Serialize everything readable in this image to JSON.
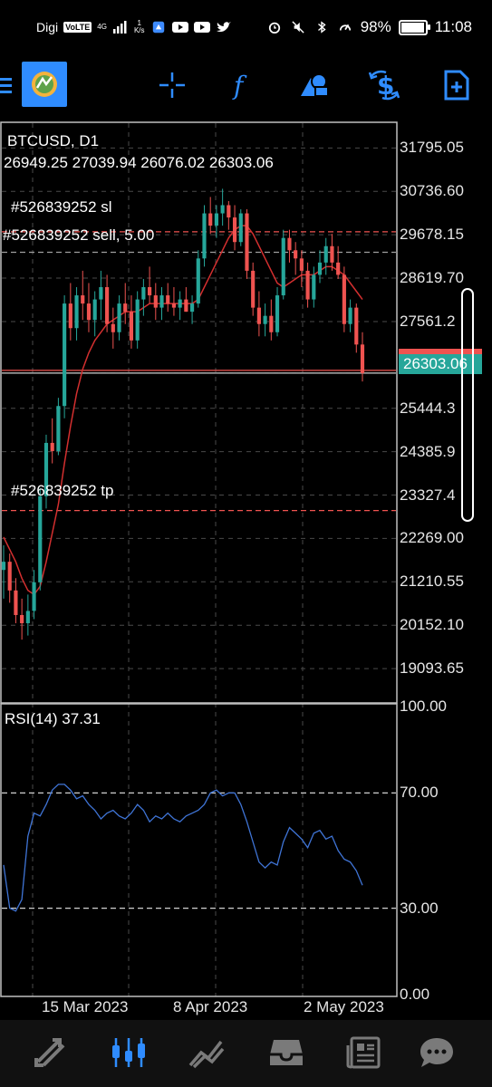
{
  "status_bar": {
    "carrier": "Digi",
    "volte": "VoLTE",
    "network": "4G",
    "speed_top": "1",
    "speed_bottom": "K/s",
    "battery": "98%",
    "time": "11:08"
  },
  "toolbar": {
    "icons": [
      "menu-icon",
      "app-logo-icon",
      "crosshair-icon",
      "function-icon",
      "objects-icon",
      "symbol-change-icon",
      "new-order-icon"
    ]
  },
  "chart": {
    "symbol_line": "BTCUSD, D1",
    "ohlc_line": "26949.25 27039.94 26076.02 26303.06",
    "sl_label": "#526839252 sl",
    "sell_label": "#526839252 sell, 5.00",
    "tp_label": "#526839252 tp",
    "price_tag": "26303.06",
    "rsi_label": "RSI(14) 37.31"
  },
  "chart_data": {
    "type": "candlestick",
    "symbol": "BTCUSD",
    "timeframe": "D1",
    "y_ticks": [
      "31795.05",
      "30736.60",
      "29678.15",
      "28619.70",
      "27561.2",
      "26303.06",
      "25444.3",
      "24385.9",
      "23327.4",
      "22269.00",
      "21210.55",
      "20152.10",
      "19093.65"
    ],
    "x_ticks": [
      "15 Mar 2023",
      "8 Apr 2023",
      "2 May 2023"
    ],
    "ylim": [
      18300,
      32400
    ],
    "sl_level": 29750,
    "sell_level": 29250,
    "tp_level": 22950,
    "current_price": 26303.06,
    "candles": [
      [
        21500,
        22100,
        20800,
        21700
      ],
      [
        21700,
        21900,
        20700,
        21000
      ],
      [
        21000,
        21300,
        20200,
        20400
      ],
      [
        20400,
        20800,
        19800,
        20200
      ],
      [
        20200,
        20900,
        19900,
        20500
      ],
      [
        20500,
        21500,
        20300,
        21200
      ],
      [
        21200,
        23500,
        21000,
        23300
      ],
      [
        23300,
        24800,
        23000,
        24600
      ],
      [
        24600,
        25200,
        24100,
        24400
      ],
      [
        24400,
        25700,
        24300,
        25500
      ],
      [
        25500,
        28200,
        25200,
        28000
      ],
      [
        28000,
        28500,
        27100,
        27400
      ],
      [
        27400,
        28400,
        27100,
        28200
      ],
      [
        28200,
        28800,
        27600,
        28000
      ],
      [
        28000,
        28500,
        27300,
        27600
      ],
      [
        27600,
        28300,
        27200,
        28100
      ],
      [
        28100,
        28800,
        27600,
        28400
      ],
      [
        28400,
        28700,
        27300,
        27500
      ],
      [
        27500,
        27900,
        26900,
        27300
      ],
      [
        27300,
        28200,
        27100,
        28000
      ],
      [
        28000,
        28500,
        27500,
        27800
      ],
      [
        27800,
        28200,
        26900,
        27100
      ],
      [
        27100,
        28300,
        26900,
        28100
      ],
      [
        28100,
        28600,
        27700,
        28400
      ],
      [
        28400,
        28900,
        28000,
        28200
      ],
      [
        28200,
        28500,
        27600,
        27900
      ],
      [
        27900,
        28400,
        27600,
        28200
      ],
      [
        28200,
        28500,
        27800,
        28000
      ],
      [
        28000,
        28400,
        27700,
        27900
      ],
      [
        27900,
        28300,
        27600,
        28100
      ],
      [
        28100,
        28400,
        27800,
        27800
      ],
      [
        27800,
        28200,
        27500,
        28000
      ],
      [
        28000,
        29300,
        27900,
        29100
      ],
      [
        29100,
        30400,
        28900,
        30200
      ],
      [
        30200,
        30600,
        29700,
        29900
      ],
      [
        29900,
        30400,
        29600,
        30200
      ],
      [
        30200,
        30800,
        29900,
        30400
      ],
      [
        30400,
        30500,
        29800,
        30100
      ],
      [
        30100,
        30400,
        29300,
        29500
      ],
      [
        29500,
        30300,
        29400,
        30200
      ],
      [
        30200,
        30300,
        28600,
        28800
      ],
      [
        28800,
        29000,
        27700,
        27900
      ],
      [
        27900,
        28300,
        27200,
        27500
      ],
      [
        27500,
        28000,
        27200,
        27700
      ],
      [
        27700,
        28100,
        27100,
        27300
      ],
      [
        27300,
        28400,
        27200,
        28200
      ],
      [
        28200,
        29800,
        28100,
        29600
      ],
      [
        29600,
        29800,
        29000,
        29300
      ],
      [
        29300,
        29500,
        28700,
        29100
      ],
      [
        29100,
        29300,
        28400,
        28800
      ],
      [
        28800,
        29000,
        27900,
        28100
      ],
      [
        28100,
        28900,
        27900,
        28700
      ],
      [
        28700,
        29300,
        28500,
        29000
      ],
      [
        29000,
        29600,
        28700,
        29400
      ],
      [
        29400,
        29700,
        28800,
        29000
      ],
      [
        29000,
        29400,
        28600,
        28700
      ],
      [
        28700,
        28900,
        27300,
        27500
      ],
      [
        27500,
        28100,
        27300,
        27900
      ],
      [
        27900,
        28000,
        26800,
        27000
      ],
      [
        27000,
        27300,
        26100,
        26303
      ]
    ],
    "ma_values": [
      22300,
      22000,
      21700,
      21300,
      21000,
      20900,
      21100,
      21700,
      22400,
      23100,
      24100,
      25000,
      25800,
      26400,
      26800,
      27100,
      27300,
      27500,
      27600,
      27700,
      27800,
      27800,
      27800,
      27900,
      28000,
      28000,
      28000,
      28000,
      28000,
      28000,
      28000,
      28000,
      28100,
      28400,
      28700,
      29000,
      29300,
      29600,
      29800,
      29900,
      29900,
      29700,
      29400,
      29100,
      28800,
      28500,
      28400,
      28500,
      28600,
      28700,
      28700,
      28700,
      28800,
      28900,
      28900,
      28800,
      28700,
      28500,
      28300,
      28100
    ],
    "rsi": {
      "period": 14,
      "value": 37.31,
      "y_ticks": [
        "100.00",
        "70.00",
        "30.00",
        "0.00"
      ],
      "levels": [
        70,
        30
      ],
      "values": [
        45,
        30,
        29,
        33,
        55,
        63,
        62,
        66,
        71,
        73,
        73,
        71,
        68,
        69,
        66,
        64,
        61,
        63,
        64,
        62,
        61,
        63,
        66,
        64,
        60,
        62,
        61,
        63,
        61,
        60,
        62,
        63,
        64,
        66,
        70,
        71,
        69,
        70,
        70,
        66,
        60,
        53,
        46,
        44,
        46,
        45,
        53,
        58,
        56,
        54,
        51,
        56,
        57,
        54,
        55,
        50,
        47,
        46,
        43,
        38
      ]
    }
  },
  "colors": {
    "bull": "#26a69a",
    "bear": "#ef5350",
    "ma": "#d32f2f",
    "rsi": "#3f74d6",
    "grid": "#4a4a4a",
    "accent": "#2f8cff"
  },
  "bottom_nav": {
    "items": [
      "quotes-icon",
      "chart-icon",
      "trade-icon",
      "history-icon",
      "news-icon",
      "messages-icon"
    ]
  }
}
